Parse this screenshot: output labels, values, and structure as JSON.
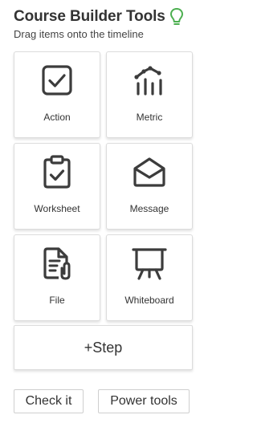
{
  "header": {
    "title": "Course Builder Tools",
    "subtitle": "Drag items onto the timeline",
    "icon": "lightbulb-icon",
    "icon_color": "#4caf50"
  },
  "tools": [
    {
      "label": "Action",
      "icon": "checkbox-icon"
    },
    {
      "label": "Metric",
      "icon": "metric-chart-icon"
    },
    {
      "label": "Worksheet",
      "icon": "clipboard-check-icon"
    },
    {
      "label": "Message",
      "icon": "envelope-open-icon"
    },
    {
      "label": "File",
      "icon": "file-attachment-icon"
    },
    {
      "label": "Whiteboard",
      "icon": "easel-whiteboard-icon"
    }
  ],
  "step_button": {
    "label": "+Step"
  },
  "footer": {
    "check_label": "Check it",
    "power_label": "Power tools"
  },
  "colors": {
    "icon_stroke": "#3c3c3c",
    "tile_border": "#dcdcdc",
    "text": "#333333"
  }
}
